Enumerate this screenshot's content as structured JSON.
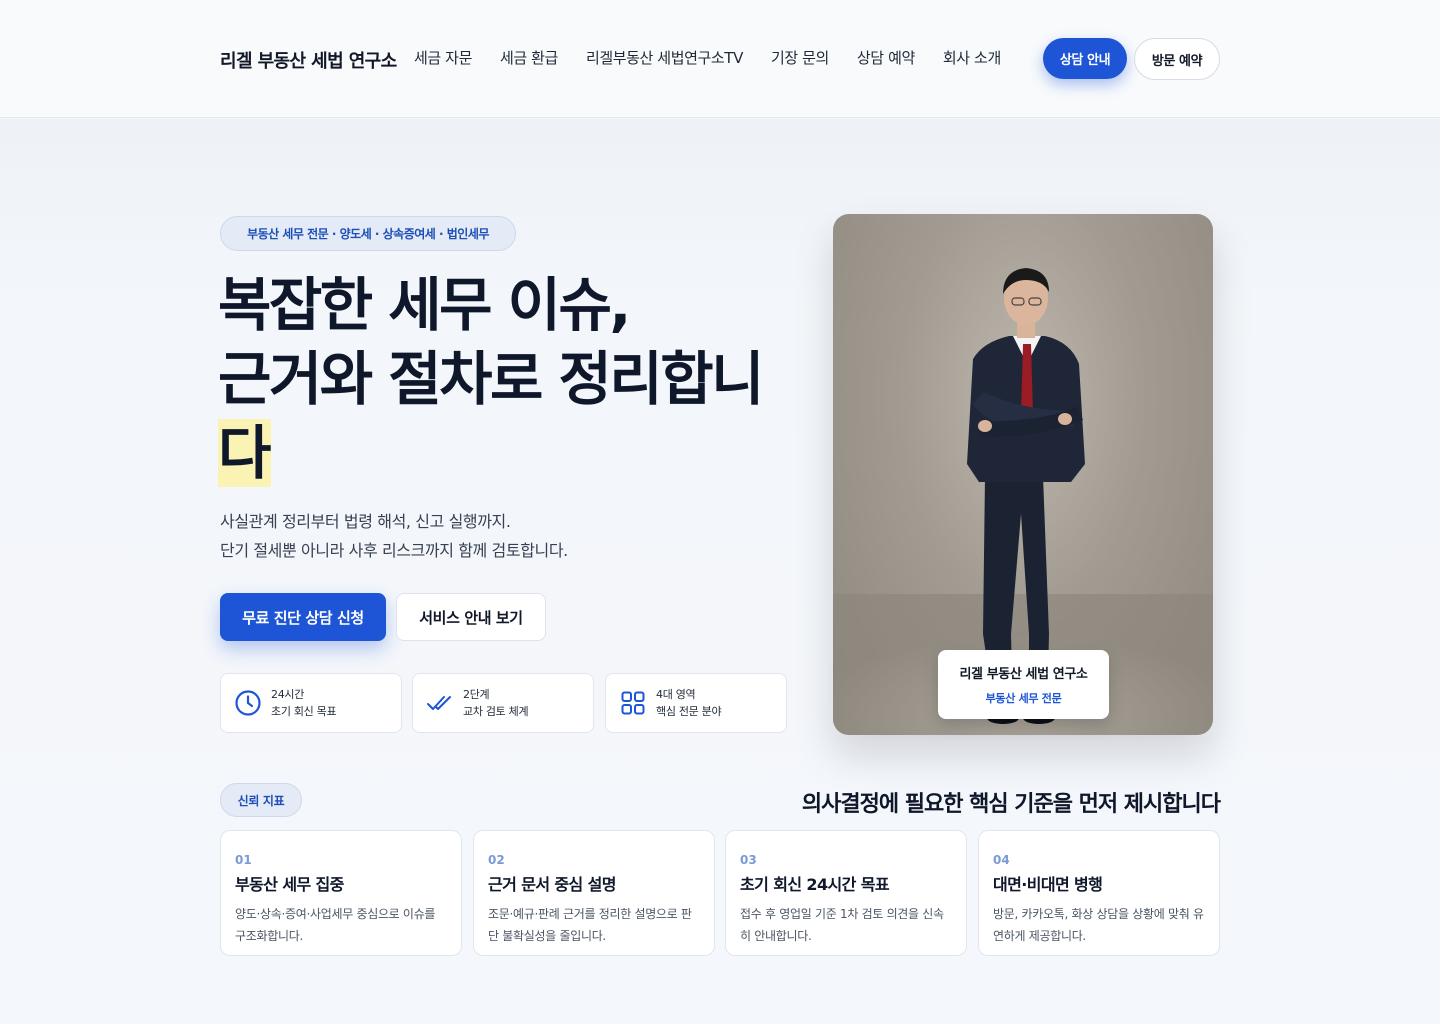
{
  "header": {
    "brand": "리겔 부동산 세법 연구소",
    "nav": [
      {
        "label": "세금 자문"
      },
      {
        "label": "세금 환급"
      },
      {
        "label": "리겔부동산 세법연구소TV"
      },
      {
        "label": "기장 문의"
      },
      {
        "label": "상담 예약"
      },
      {
        "label": "회사 소개"
      }
    ],
    "consult_button": "상담 안내",
    "visit_button": "방문 예약"
  },
  "hero": {
    "tag": "부동산 세무 전문 · 양도세 · 상속증여세 · 법인세무",
    "title_line1": "복잡한 세무 이슈,",
    "title_line2": "근거와 절차로 정리합니",
    "title_line3": "다",
    "desc_line1": "사실관계 정리부터 법령 해석, 신고 실행까지.",
    "desc_line2": "단기 절세뿐 아니라 사후 리스크까지 함께 검토합니다.",
    "primary_button": "무료 진단 상담 신청",
    "secondary_button": "서비스 안내 보기",
    "stats": [
      {
        "icon": "clock-icon",
        "line1": "24시간",
        "line2": "초기 회신 목표"
      },
      {
        "icon": "double-check-icon",
        "line1": "2단계",
        "line2": "교차 검토 체계"
      },
      {
        "icon": "grid-icon",
        "line1": "4대 영역",
        "line2": "핵심 전문 분야"
      }
    ]
  },
  "photo": {
    "label_title": "리겔 부동산 세법 연구소",
    "label_sub": "부동산 세무 전문"
  },
  "trust": {
    "pill": "신뢰 지표",
    "heading": "의사결정에 필요한 핵심 기준을 먼저 제시합니다",
    "cards": [
      {
        "num": "01",
        "title": "부동산 세무 집중",
        "desc": "양도·상속·증여·사업세무 중심으로 이슈를 구조화합니다."
      },
      {
        "num": "02",
        "title": "근거 문서 중심 설명",
        "desc": "조문·예규·판례 근거를 정리한 설명으로 판단 불확실성을 줄입니다."
      },
      {
        "num": "03",
        "title": "초기 회신 24시간 목표",
        "desc": "접수 후 영업일 기준 1차 검토 의견을 신속히 안내합니다."
      },
      {
        "num": "04",
        "title": "대면·비대면 병행",
        "desc": "방문, 카카오톡, 화상 상담을 상황에 맞춰 유연하게 제공합니다."
      }
    ]
  },
  "colors": {
    "accent": "#1d55d6",
    "highlight": "#fbf3b4",
    "dark_text": "#0f172a"
  }
}
